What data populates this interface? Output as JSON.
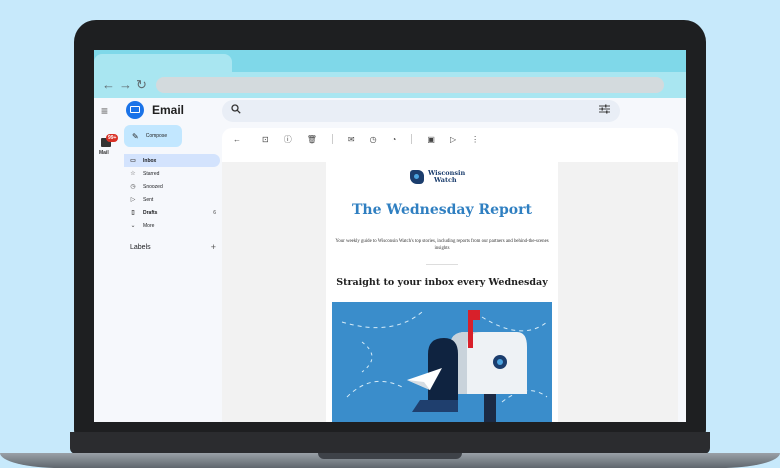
{
  "browser": {
    "back_icon": "arrow-left-icon",
    "forward_icon": "arrow-right-icon",
    "reload_icon": "reload-icon"
  },
  "app": {
    "title": "Email",
    "mail_rail_label": "Mail",
    "mail_badge": "99+",
    "compose_label": "Compose",
    "nav": [
      {
        "label": "Inbox",
        "icon": "inbox-icon",
        "active": true
      },
      {
        "label": "Starred",
        "icon": "star-icon"
      },
      {
        "label": "Snoozed",
        "icon": "clock-icon"
      },
      {
        "label": "Sent",
        "icon": "send-icon"
      },
      {
        "label": "Drafts",
        "icon": "draft-icon",
        "count": "6"
      },
      {
        "label": "More",
        "icon": "chevron-down-icon"
      }
    ],
    "labels_title": "Labels"
  },
  "newsletter": {
    "logo_line1": "Wisconsin",
    "logo_line2": "Watch",
    "title": "The Wednesday Report",
    "subtitle": "Your weekly guide to Wisconsin Watch's top stories, including reports from our partners and behind-the-scenes insights",
    "heading": "Straight to your inbox every Wednesday"
  },
  "colors": {
    "background": "#c7e9fb",
    "tabstrip": "#7fd8e9",
    "accent": "#2f7fc1",
    "compose": "#c2e7ff",
    "hero": "#3a8dcb"
  }
}
